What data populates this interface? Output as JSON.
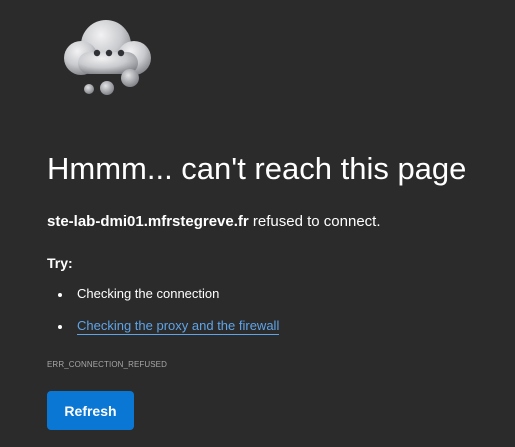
{
  "illustration": {
    "icon": "cloud-icon",
    "colors": {
      "cloud_light": "#e6e6e8",
      "cloud_dark": "#8d8f95",
      "dots": "#2f3136"
    }
  },
  "error": {
    "title": "Hmmm... can't reach this page",
    "host": "ste-lab-dmi01.mfrstegreve.fr",
    "message_suffix": " refused to connect.",
    "try_label": "Try:",
    "suggestions": [
      {
        "label": "Checking the connection",
        "is_link": false
      },
      {
        "label": "Checking the proxy and the firewall",
        "is_link": true
      }
    ],
    "code": "ERR_CONNECTION_REFUSED"
  },
  "actions": {
    "refresh_label": "Refresh"
  },
  "colors": {
    "background": "#2b2b2b",
    "text": "#ffffff",
    "link": "#5fa4e8",
    "muted": "#a6a6a6",
    "accent": "#0b77d4"
  }
}
